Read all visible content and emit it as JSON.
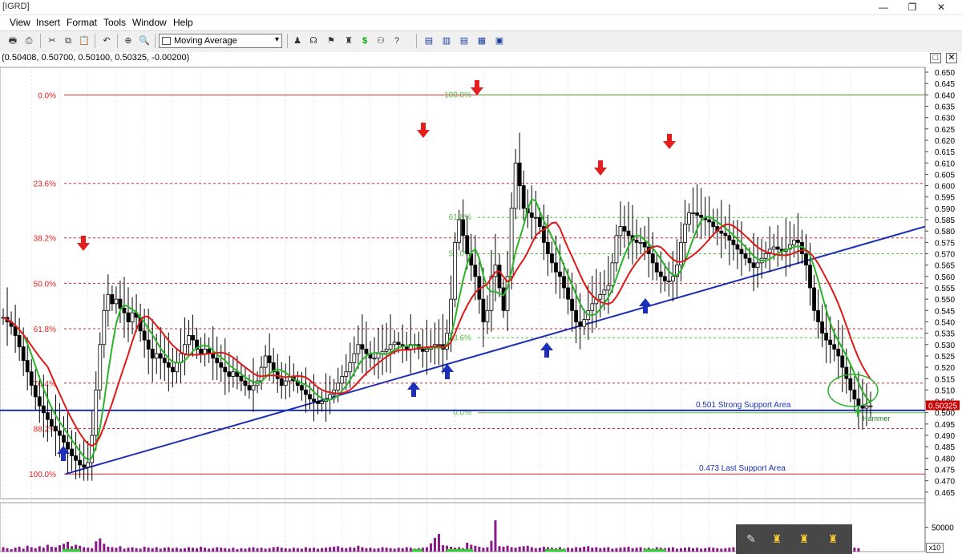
{
  "window": {
    "title": "[IGRD]"
  },
  "menu": [
    "View",
    "Insert",
    "Format",
    "Tools",
    "Window",
    "Help"
  ],
  "toolbar": {
    "indicator_select": "Moving Average"
  },
  "ohlc_readout": "(0.50408, 0.50700, 0.50100, 0.50325, -0.00200)",
  "chart_data": {
    "type": "candlestick",
    "price_axis": {
      "min": 0.46,
      "max": 0.65,
      "step": 0.005
    },
    "current_price": "0.50325",
    "fib_left": [
      {
        "label": "0.0%",
        "value": 0.64
      },
      {
        "label": "23.6%",
        "value": 0.601
      },
      {
        "label": "38.2%",
        "value": 0.577
      },
      {
        "label": "50.0%",
        "value": 0.557
      },
      {
        "label": "61.8%",
        "value": 0.537
      },
      {
        "label": "76.4%",
        "value": 0.513
      },
      {
        "label": "88.2%",
        "value": 0.493
      },
      {
        "label": "100.0%",
        "value": 0.473
      }
    ],
    "fib_right": [
      {
        "label": "100.0%",
        "value": 0.64
      },
      {
        "label": "61.8%",
        "value": 0.586
      },
      {
        "label": "50.0%",
        "value": 0.57
      },
      {
        "label": "23.6%",
        "value": 0.533
      },
      {
        "label": "0.0%",
        "value": 0.5
      }
    ],
    "support_lines": [
      {
        "label": "0.501 Strong Support Area",
        "value": 0.501
      },
      {
        "label": "0.473 Last Support Area",
        "value": 0.473
      }
    ],
    "annotation": "Hammer",
    "volume_axis": {
      "label": "50000",
      "max": 100000
    },
    "close": [
      0.542,
      0.54,
      0.538,
      0.534,
      0.529,
      0.523,
      0.518,
      0.512,
      0.507,
      0.503,
      0.5,
      0.497,
      0.494,
      0.492,
      0.49,
      0.487,
      0.484,
      0.481,
      0.479,
      0.477,
      0.476,
      0.478,
      0.49,
      0.51,
      0.53,
      0.545,
      0.552,
      0.548,
      0.55,
      0.546,
      0.544,
      0.54,
      0.544,
      0.542,
      0.536,
      0.532,
      0.528,
      0.524,
      0.526,
      0.524,
      0.522,
      0.52,
      0.518,
      0.522,
      0.526,
      0.53,
      0.534,
      0.532,
      0.528,
      0.526,
      0.528,
      0.526,
      0.524,
      0.522,
      0.52,
      0.518,
      0.516,
      0.518,
      0.516,
      0.514,
      0.512,
      0.51,
      0.512,
      0.514,
      0.52,
      0.525,
      0.522,
      0.518,
      0.515,
      0.512,
      0.514,
      0.516,
      0.514,
      0.512,
      0.51,
      0.508,
      0.506,
      0.505,
      0.504,
      0.505,
      0.506,
      0.508,
      0.51,
      0.513,
      0.516,
      0.518,
      0.522,
      0.526,
      0.53,
      0.528,
      0.526,
      0.524,
      0.524,
      0.526,
      0.527,
      0.528,
      0.53,
      0.531,
      0.53,
      0.529,
      0.528,
      0.53,
      0.53,
      0.528,
      0.527,
      0.528,
      0.529,
      0.53,
      0.53,
      0.528,
      0.535,
      0.55,
      0.575,
      0.585,
      0.578,
      0.57,
      0.565,
      0.56,
      0.55,
      0.54,
      0.545,
      0.56,
      0.565,
      0.555,
      0.545,
      0.56,
      0.59,
      0.61,
      0.6,
      0.59,
      0.588,
      0.586,
      0.586,
      0.582,
      0.575,
      0.57,
      0.566,
      0.562,
      0.56,
      0.555,
      0.55,
      0.545,
      0.54,
      0.538,
      0.541,
      0.545,
      0.548,
      0.55,
      0.552,
      0.554,
      0.556,
      0.566,
      0.578,
      0.582,
      0.58,
      0.578,
      0.576,
      0.575,
      0.575,
      0.573,
      0.57,
      0.566,
      0.562,
      0.56,
      0.558,
      0.558,
      0.56,
      0.565,
      0.575,
      0.583,
      0.588,
      0.588,
      0.587,
      0.586,
      0.585,
      0.584,
      0.582,
      0.58,
      0.579,
      0.578,
      0.576,
      0.574,
      0.572,
      0.57,
      0.568,
      0.566,
      0.564,
      0.566,
      0.568,
      0.57,
      0.572,
      0.573,
      0.572,
      0.571,
      0.572,
      0.574,
      0.576,
      0.575,
      0.57,
      0.565,
      0.555,
      0.545,
      0.54,
      0.535,
      0.532,
      0.53,
      0.528,
      0.525,
      0.52,
      0.515,
      0.51,
      0.506,
      0.503,
      0.502,
      0.503,
      0.503
    ],
    "volume": [
      9,
      7,
      5,
      8,
      10,
      6,
      12,
      9,
      7,
      11,
      8,
      14,
      10,
      9,
      13,
      16,
      20,
      11,
      14,
      12,
      9,
      8,
      7,
      21,
      27,
      16,
      10,
      9,
      8,
      11,
      6,
      8,
      9,
      7,
      6,
      10,
      8,
      7,
      9,
      6,
      8,
      9,
      7,
      8,
      6,
      7,
      9,
      8,
      7,
      10,
      8,
      6,
      7,
      9,
      8,
      7,
      6,
      8,
      5,
      7,
      6,
      8,
      9,
      7,
      8,
      6,
      7,
      9,
      10,
      8,
      7,
      6,
      8,
      7,
      6,
      9,
      7,
      8,
      6,
      7,
      8,
      9,
      10,
      11,
      8,
      7,
      9,
      8,
      12,
      9,
      7,
      8,
      6,
      7,
      9,
      8,
      7,
      6,
      8,
      7,
      9,
      8,
      6,
      7,
      8,
      9,
      17,
      28,
      36,
      13,
      12,
      10,
      8,
      9,
      7,
      18,
      14,
      12,
      10,
      8,
      9,
      22,
      64,
      11,
      10,
      12,
      9,
      8,
      10,
      11,
      12,
      9,
      7,
      8,
      10,
      9,
      8,
      7,
      9,
      6,
      8,
      7,
      9,
      8,
      10,
      11,
      8,
      9,
      7,
      8,
      9,
      6,
      7,
      8,
      9,
      10,
      7,
      8,
      9,
      7,
      8,
      6,
      9,
      8,
      7,
      8,
      9,
      6,
      7,
      8,
      9,
      7,
      8,
      6,
      7,
      9,
      8,
      7,
      6,
      7,
      8,
      9,
      10,
      7,
      6,
      8,
      7,
      9,
      8,
      7,
      6,
      8,
      9,
      10,
      7,
      6,
      8,
      9,
      7,
      8,
      6,
      9,
      7,
      8,
      9,
      10,
      12,
      8,
      7,
      9,
      6,
      8,
      7
    ]
  }
}
